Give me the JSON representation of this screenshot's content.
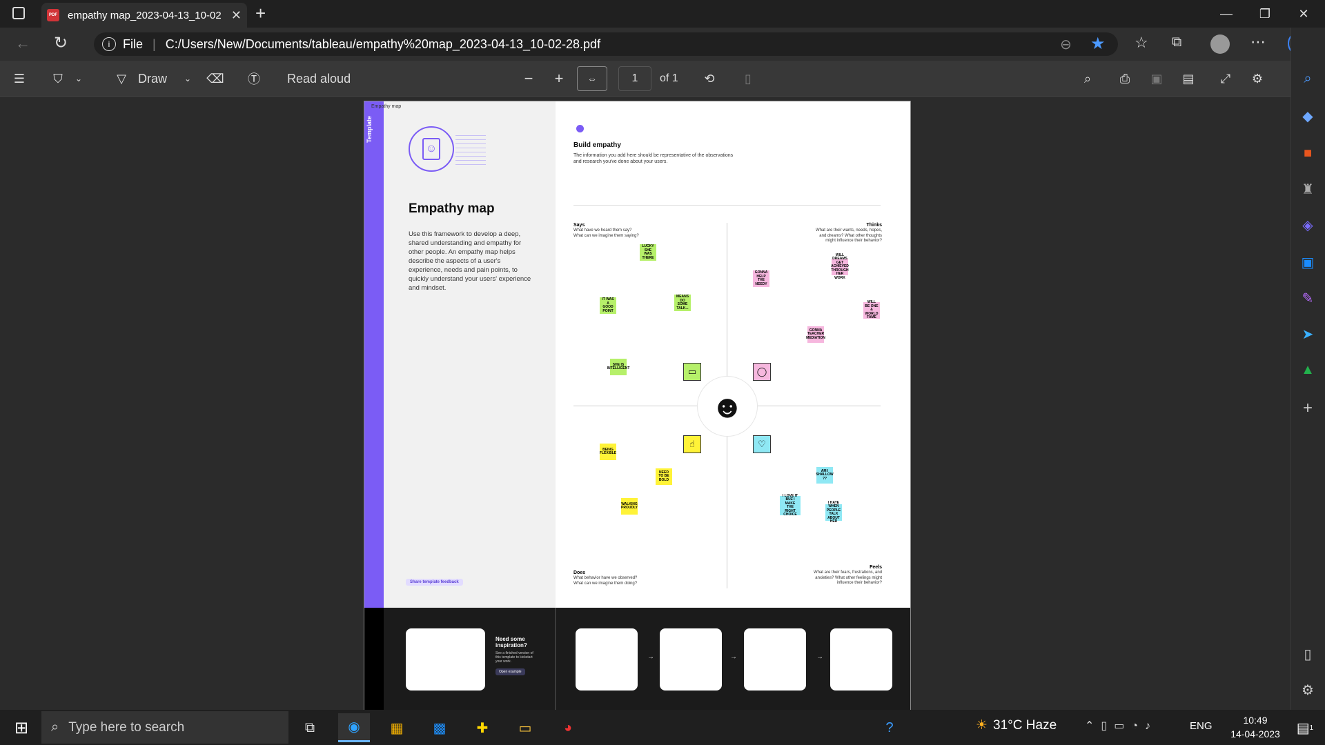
{
  "browser": {
    "tab_title": "empathy map_2023-04-13_10-02",
    "url_scheme_label": "File",
    "url": "C:/Users/New/Documents/tableau/empathy%20map_2023-04-13_10-02-28.pdf"
  },
  "pdf_toolbar": {
    "draw_label": "Draw",
    "read_aloud_label": "Read aloud",
    "page_number": "1",
    "page_total": "of 1"
  },
  "document": {
    "template_tag": "Template",
    "breadcrumb": "Empathy map",
    "title": "Empathy map",
    "description": "Use this framework to develop a deep, shared understanding and empathy for other people. An empathy map helps describe the aspects of a user's experience, needs and pain points, to quickly understand your users' experience and mindset.",
    "feedback_label": "Share template feedback",
    "build_title": "Build empathy",
    "build_text": "The information you add here should be representative of the observations and research you've done about your users.",
    "says_title": "Says",
    "says_text": "What have we heard them say? What can we imagine them saying?",
    "thinks_title": "Thinks",
    "thinks_text": "What are their wants, needs, hopes, and dreams? What other thoughts might influence their behavior?",
    "does_title": "Does",
    "does_text": "What behavior have we observed? What can we imagine them doing?",
    "feels_title": "Feels",
    "feels_text": "What are their fears, frustrations, and anxieties? What other feelings might influence their behavior?",
    "inspiration_title": "Need some inspiration?",
    "inspiration_text": "See a finished version of this template to kickstart your work.",
    "open_example_label": "Open example",
    "stickies": {
      "s1": "LUCKY SHE WAS THERE",
      "s2": "IT WAS A GOOD POINT",
      "s3": "MEANS DO SOME TALK...",
      "s4": "SHE IS INTELLIGENT",
      "t1": "GONNA HELP THE NEEDY",
      "t2": "WILL DREAMS GET ACHIEVED THROUGH HER WORK",
      "t3": "WILL BE ONE & WORLD FAME",
      "t4": "GONNA TEACHER MEDIATION",
      "d1": "BEING FLEXIBLE",
      "d2": "NEED TO BE BOLD",
      "d3": "WALKING PROUDLY",
      "f1": "AM I SHALLOW ??",
      "f2": "I LOVE IT BUZ I MAKE THE RIGHT CHOICE",
      "f3": "I HATE WHEN PEOPLE TALK ABOUT HER"
    }
  },
  "taskbar": {
    "search_placeholder": "Type here to search",
    "weather": "31°C  Haze",
    "language": "ENG",
    "time": "10:49",
    "date": "14-04-2023",
    "notification_count": "1"
  }
}
